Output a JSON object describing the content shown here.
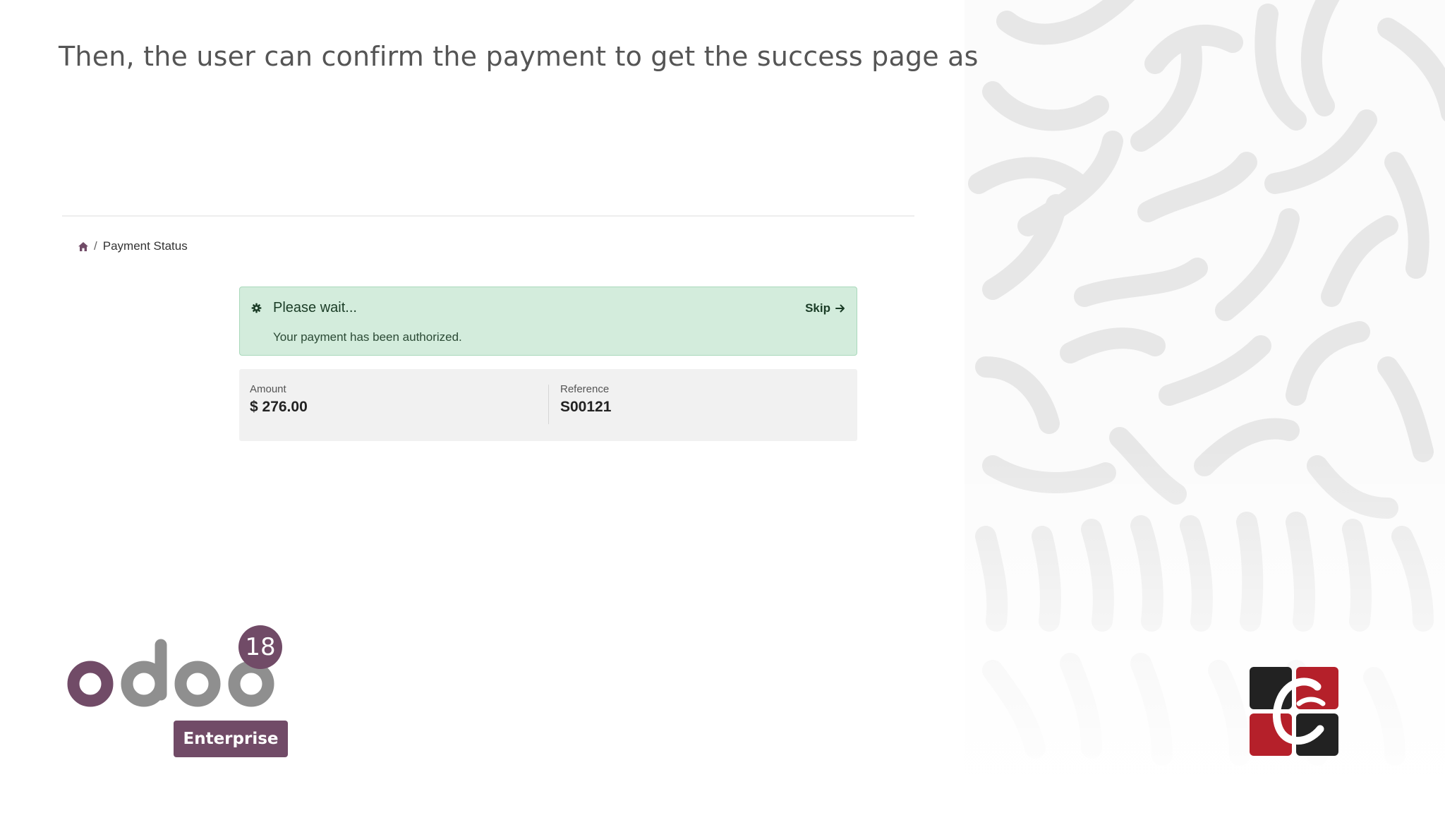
{
  "slide": {
    "heading": "Then, the user can confirm the payment to get the success page as"
  },
  "breadcrumb": {
    "home_icon": "home-icon",
    "separator": "/",
    "current": "Payment Status"
  },
  "status_alert": {
    "icon": "gear-icon",
    "title": "Please wait...",
    "skip_label": "Skip",
    "skip_icon": "arrow-right-icon",
    "message": "Your payment has been authorized.",
    "background_color": "#d3ecdc"
  },
  "summary": {
    "amount_label": "Amount",
    "amount_value": "$ 276.00",
    "reference_label": "Reference",
    "reference_value": "S00121"
  },
  "branding": {
    "product_logo": "odoo-logo",
    "version": "18",
    "edition": "Enterprise",
    "brand_color": "#714b67",
    "company_logo": "company-logo"
  }
}
